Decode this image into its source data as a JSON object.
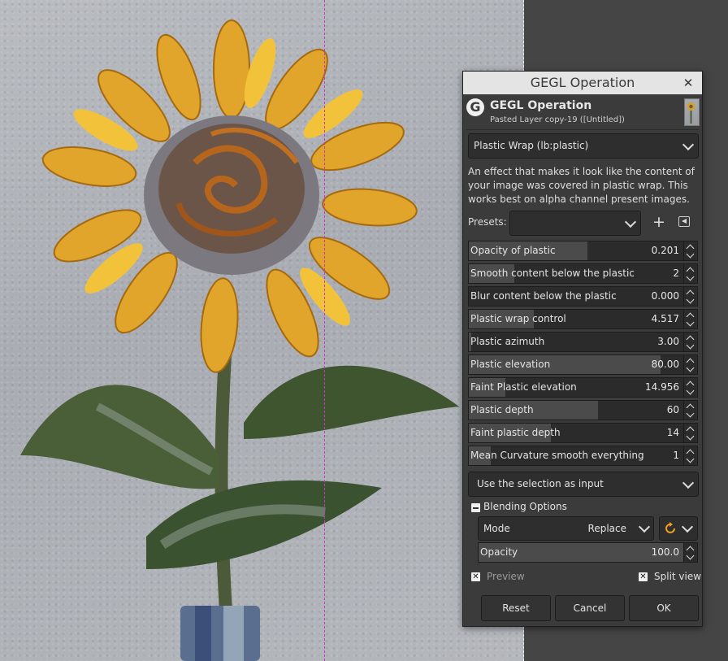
{
  "dialog": {
    "window_title": "GEGL Operation",
    "header_title": "GEGL Operation",
    "header_subtitle": "Pasted Layer copy-19 ([Untitled])",
    "operation": "Plastic Wrap (lb:plastic)",
    "description": "An effect that makes it look like the content of your image was covered in plastic wrap. This works best on alpha channel present images.",
    "presets_label": "Presets:",
    "presets_value": "",
    "params": [
      {
        "label": "Opacity of plastic",
        "value": "0.201",
        "fill": 0.55
      },
      {
        "label": "Smooth content below the plastic",
        "value": "2",
        "fill": 0.21
      },
      {
        "label": "Blur content below the plastic",
        "value": "0.000",
        "fill": 0.0
      },
      {
        "label": "Plastic wrap control",
        "value": "4.517",
        "fill": 0.3
      },
      {
        "label": "Plastic azimuth",
        "value": "3.00",
        "fill": 0.01
      },
      {
        "label": "Plastic elevation",
        "value": "80.00",
        "fill": 0.89
      },
      {
        "label": "Faint Plastic elevation",
        "value": "14.956",
        "fill": 0.17
      },
      {
        "label": "Plastic depth",
        "value": "60",
        "fill": 0.6
      },
      {
        "label": "Faint plastic depth",
        "value": "14",
        "fill": 0.38
      },
      {
        "label": "Mean Curvature smooth everything",
        "value": "1",
        "fill": 0.1
      }
    ],
    "input_mode": "Use the selection as input",
    "blending": {
      "section_label": "Blending Options",
      "mode_label": "Mode",
      "mode_value": "Replace",
      "opacity_label": "Opacity",
      "opacity_value": "100.0",
      "opacity_fill": 1.0
    },
    "preview_label": "Preview",
    "split_view_label": "Split view",
    "buttons": {
      "reset": "Reset",
      "cancel": "Cancel",
      "ok": "OK"
    }
  }
}
